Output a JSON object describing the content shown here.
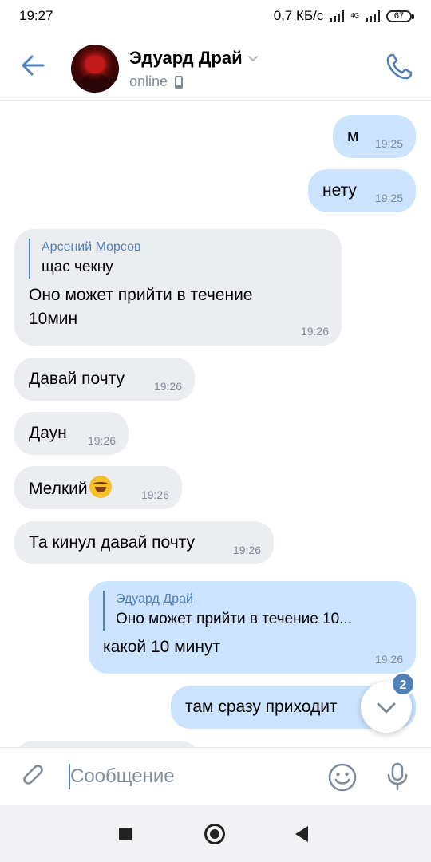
{
  "status_bar": {
    "time": "19:27",
    "speed": "0,7 КБ/с",
    "network": "4G",
    "battery": "67"
  },
  "header": {
    "name": "Эдуард Драй",
    "status": "online",
    "icons": [
      "back-arrow-icon",
      "chevron-down-icon",
      "mobile-icon",
      "phone-icon"
    ]
  },
  "messages": [
    {
      "dir": "out",
      "text": "м",
      "time": "19:25"
    },
    {
      "dir": "out",
      "text": "нету",
      "time": "19:25"
    },
    {
      "dir": "in",
      "reply_author": "Арсений Морсов",
      "reply_text": "щас чекну",
      "text_lines": [
        "Оно может прийти в течение",
        "10мин"
      ],
      "time": "19:26"
    },
    {
      "dir": "in",
      "text": "Давай почту",
      "time": "19:26"
    },
    {
      "dir": "in",
      "text": "Даун",
      "time": "19:26"
    },
    {
      "dir": "in",
      "text": "Мелкий",
      "emoji": "rolling-laughing-emoji",
      "time": "19:26"
    },
    {
      "dir": "in",
      "text": "Та кинул давай почту",
      "time": "19:26"
    },
    {
      "dir": "out",
      "reply_author": "Эдуард Драй",
      "reply_text": "Оно может прийти в течение 10...",
      "text": "какой 10 минут",
      "time": "19:26"
    },
    {
      "dir": "out",
      "text": "там сразу приходит"
    }
  ],
  "scroll_down": {
    "badge": "2"
  },
  "composer": {
    "placeholder": "Сообщение",
    "icons": [
      "paperclip-icon",
      "smile-icon",
      "microphone-icon"
    ]
  },
  "colors": {
    "accent": "#5181b8",
    "out_bubble": "#cce4ff",
    "in_bubble": "#ebedf0",
    "time": "#818c99"
  }
}
